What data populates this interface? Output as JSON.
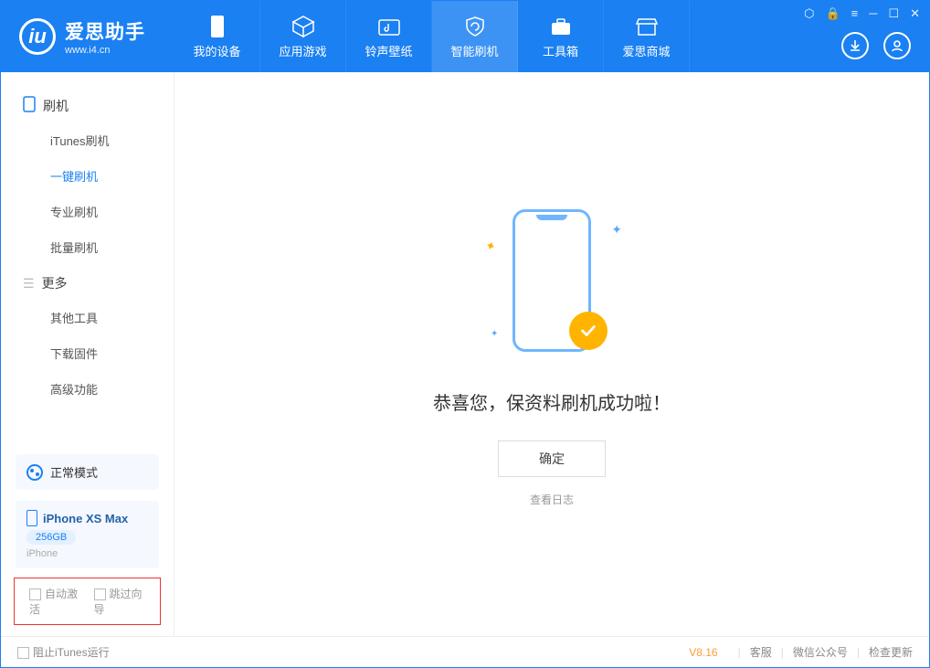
{
  "app": {
    "name": "爱思助手",
    "url": "www.i4.cn"
  },
  "nav": [
    {
      "label": "我的设备"
    },
    {
      "label": "应用游戏"
    },
    {
      "label": "铃声壁纸"
    },
    {
      "label": "智能刷机"
    },
    {
      "label": "工具箱"
    },
    {
      "label": "爱思商城"
    }
  ],
  "sidebar": {
    "group1": {
      "title": "刷机"
    },
    "items1": [
      {
        "label": "iTunes刷机"
      },
      {
        "label": "一键刷机"
      },
      {
        "label": "专业刷机"
      },
      {
        "label": "批量刷机"
      }
    ],
    "group2": {
      "title": "更多"
    },
    "items2": [
      {
        "label": "其他工具"
      },
      {
        "label": "下载固件"
      },
      {
        "label": "高级功能"
      }
    ]
  },
  "mode": {
    "label": "正常模式"
  },
  "device": {
    "name": "iPhone XS Max",
    "storage": "256GB",
    "type": "iPhone"
  },
  "checks": {
    "auto_activate": "自动激活",
    "skip_guide": "跳过向导"
  },
  "main": {
    "success_text": "恭喜您，保资料刷机成功啦！",
    "ok_btn": "确定",
    "log_link": "查看日志"
  },
  "footer": {
    "block_itunes": "阻止iTunes运行",
    "version": "V8.16",
    "links": [
      "客服",
      "微信公众号",
      "检查更新"
    ]
  }
}
